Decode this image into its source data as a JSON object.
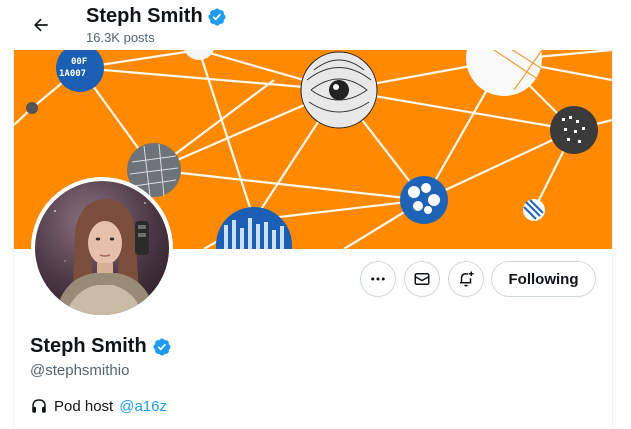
{
  "header": {
    "back_icon": "arrow-left-icon",
    "name": "Steph Smith",
    "posts": "16.3K posts"
  },
  "banner": {
    "background": "#ff8a00",
    "node_text_1": "00F",
    "node_text_2": "1A007"
  },
  "profile": {
    "name": "Steph Smith",
    "handle": "@stephsmithio",
    "verified_color": "#1d9bf0",
    "bio_icon": "headphones-icon",
    "bio_text": "Pod host",
    "bio_link": "@a16z"
  },
  "actions": {
    "more_icon": "more-horizontal-icon",
    "message_icon": "mail-icon",
    "notify_icon": "bell-plus-icon",
    "following_label": "Following"
  }
}
